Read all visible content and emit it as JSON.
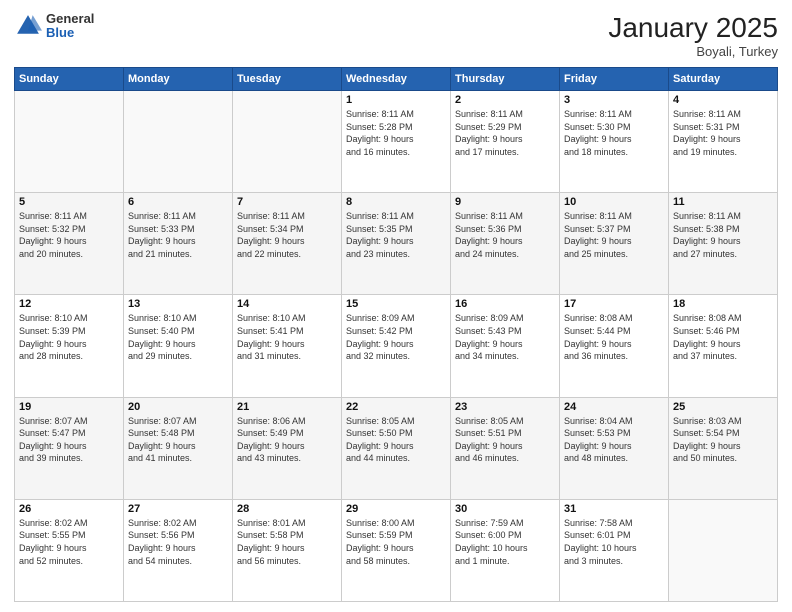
{
  "logo": {
    "general": "General",
    "blue": "Blue"
  },
  "header": {
    "month": "January 2025",
    "location": "Boyali, Turkey"
  },
  "weekdays": [
    "Sunday",
    "Monday",
    "Tuesday",
    "Wednesday",
    "Thursday",
    "Friday",
    "Saturday"
  ],
  "weeks": [
    [
      {
        "day": "",
        "info": ""
      },
      {
        "day": "",
        "info": ""
      },
      {
        "day": "",
        "info": ""
      },
      {
        "day": "1",
        "info": "Sunrise: 8:11 AM\nSunset: 5:28 PM\nDaylight: 9 hours\nand 16 minutes."
      },
      {
        "day": "2",
        "info": "Sunrise: 8:11 AM\nSunset: 5:29 PM\nDaylight: 9 hours\nand 17 minutes."
      },
      {
        "day": "3",
        "info": "Sunrise: 8:11 AM\nSunset: 5:30 PM\nDaylight: 9 hours\nand 18 minutes."
      },
      {
        "day": "4",
        "info": "Sunrise: 8:11 AM\nSunset: 5:31 PM\nDaylight: 9 hours\nand 19 minutes."
      }
    ],
    [
      {
        "day": "5",
        "info": "Sunrise: 8:11 AM\nSunset: 5:32 PM\nDaylight: 9 hours\nand 20 minutes."
      },
      {
        "day": "6",
        "info": "Sunrise: 8:11 AM\nSunset: 5:33 PM\nDaylight: 9 hours\nand 21 minutes."
      },
      {
        "day": "7",
        "info": "Sunrise: 8:11 AM\nSunset: 5:34 PM\nDaylight: 9 hours\nand 22 minutes."
      },
      {
        "day": "8",
        "info": "Sunrise: 8:11 AM\nSunset: 5:35 PM\nDaylight: 9 hours\nand 23 minutes."
      },
      {
        "day": "9",
        "info": "Sunrise: 8:11 AM\nSunset: 5:36 PM\nDaylight: 9 hours\nand 24 minutes."
      },
      {
        "day": "10",
        "info": "Sunrise: 8:11 AM\nSunset: 5:37 PM\nDaylight: 9 hours\nand 25 minutes."
      },
      {
        "day": "11",
        "info": "Sunrise: 8:11 AM\nSunset: 5:38 PM\nDaylight: 9 hours\nand 27 minutes."
      }
    ],
    [
      {
        "day": "12",
        "info": "Sunrise: 8:10 AM\nSunset: 5:39 PM\nDaylight: 9 hours\nand 28 minutes."
      },
      {
        "day": "13",
        "info": "Sunrise: 8:10 AM\nSunset: 5:40 PM\nDaylight: 9 hours\nand 29 minutes."
      },
      {
        "day": "14",
        "info": "Sunrise: 8:10 AM\nSunset: 5:41 PM\nDaylight: 9 hours\nand 31 minutes."
      },
      {
        "day": "15",
        "info": "Sunrise: 8:09 AM\nSunset: 5:42 PM\nDaylight: 9 hours\nand 32 minutes."
      },
      {
        "day": "16",
        "info": "Sunrise: 8:09 AM\nSunset: 5:43 PM\nDaylight: 9 hours\nand 34 minutes."
      },
      {
        "day": "17",
        "info": "Sunrise: 8:08 AM\nSunset: 5:44 PM\nDaylight: 9 hours\nand 36 minutes."
      },
      {
        "day": "18",
        "info": "Sunrise: 8:08 AM\nSunset: 5:46 PM\nDaylight: 9 hours\nand 37 minutes."
      }
    ],
    [
      {
        "day": "19",
        "info": "Sunrise: 8:07 AM\nSunset: 5:47 PM\nDaylight: 9 hours\nand 39 minutes."
      },
      {
        "day": "20",
        "info": "Sunrise: 8:07 AM\nSunset: 5:48 PM\nDaylight: 9 hours\nand 41 minutes."
      },
      {
        "day": "21",
        "info": "Sunrise: 8:06 AM\nSunset: 5:49 PM\nDaylight: 9 hours\nand 43 minutes."
      },
      {
        "day": "22",
        "info": "Sunrise: 8:05 AM\nSunset: 5:50 PM\nDaylight: 9 hours\nand 44 minutes."
      },
      {
        "day": "23",
        "info": "Sunrise: 8:05 AM\nSunset: 5:51 PM\nDaylight: 9 hours\nand 46 minutes."
      },
      {
        "day": "24",
        "info": "Sunrise: 8:04 AM\nSunset: 5:53 PM\nDaylight: 9 hours\nand 48 minutes."
      },
      {
        "day": "25",
        "info": "Sunrise: 8:03 AM\nSunset: 5:54 PM\nDaylight: 9 hours\nand 50 minutes."
      }
    ],
    [
      {
        "day": "26",
        "info": "Sunrise: 8:02 AM\nSunset: 5:55 PM\nDaylight: 9 hours\nand 52 minutes."
      },
      {
        "day": "27",
        "info": "Sunrise: 8:02 AM\nSunset: 5:56 PM\nDaylight: 9 hours\nand 54 minutes."
      },
      {
        "day": "28",
        "info": "Sunrise: 8:01 AM\nSunset: 5:58 PM\nDaylight: 9 hours\nand 56 minutes."
      },
      {
        "day": "29",
        "info": "Sunrise: 8:00 AM\nSunset: 5:59 PM\nDaylight: 9 hours\nand 58 minutes."
      },
      {
        "day": "30",
        "info": "Sunrise: 7:59 AM\nSunset: 6:00 PM\nDaylight: 10 hours\nand 1 minute."
      },
      {
        "day": "31",
        "info": "Sunrise: 7:58 AM\nSunset: 6:01 PM\nDaylight: 10 hours\nand 3 minutes."
      },
      {
        "day": "",
        "info": ""
      }
    ]
  ]
}
